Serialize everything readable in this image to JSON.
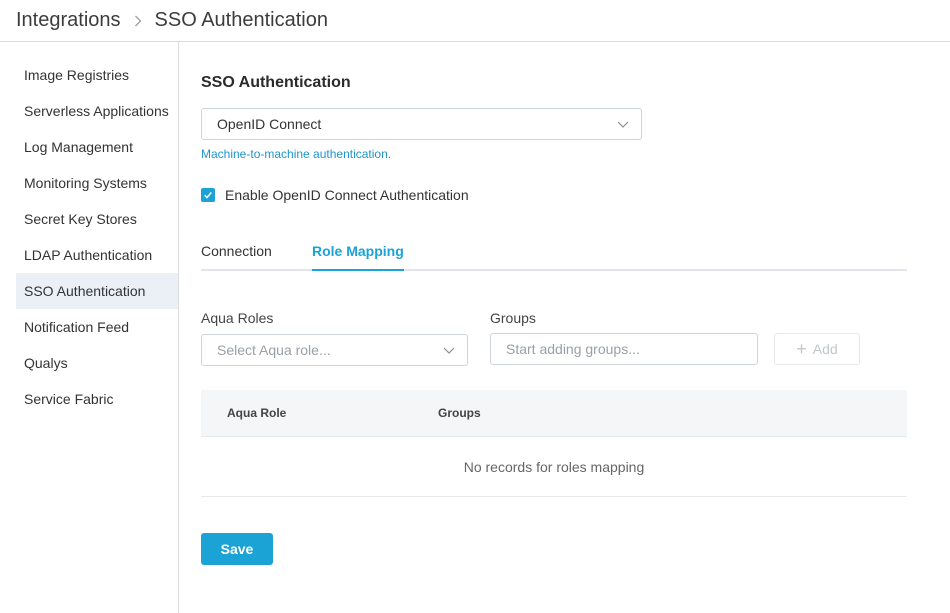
{
  "breadcrumb": {
    "items": [
      "Integrations",
      "SSO Authentication"
    ]
  },
  "sidebar": {
    "items": [
      {
        "label": "Image Registries"
      },
      {
        "label": "Serverless Applications"
      },
      {
        "label": "Log Management"
      },
      {
        "label": "Monitoring Systems"
      },
      {
        "label": "Secret Key Stores"
      },
      {
        "label": "LDAP Authentication"
      },
      {
        "label": "SSO Authentication",
        "active": true
      },
      {
        "label": "Notification Feed"
      },
      {
        "label": "Qualys"
      },
      {
        "label": "Service Fabric"
      }
    ]
  },
  "main": {
    "title": "SSO Authentication",
    "provider_select": {
      "value": "OpenID Connect"
    },
    "hint": "Machine-to-machine authentication.",
    "enable_checkbox": {
      "label": "Enable OpenID Connect Authentication",
      "checked": true
    },
    "tabs": [
      {
        "label": "Connection"
      },
      {
        "label": "Role Mapping",
        "active": true
      }
    ],
    "role_mapping": {
      "roles_label": "Aqua Roles",
      "roles_placeholder": "Select Aqua role...",
      "groups_label": "Groups",
      "groups_placeholder": "Start adding groups...",
      "add_label": "Add",
      "table": {
        "columns": [
          "Aqua Role",
          "Groups"
        ],
        "empty_text": "No records for roles mapping"
      }
    },
    "save_label": "Save"
  },
  "colors": {
    "accent": "#1aa3d4",
    "active_bg": "#eaf0f6",
    "border": "#dcdcdc"
  }
}
